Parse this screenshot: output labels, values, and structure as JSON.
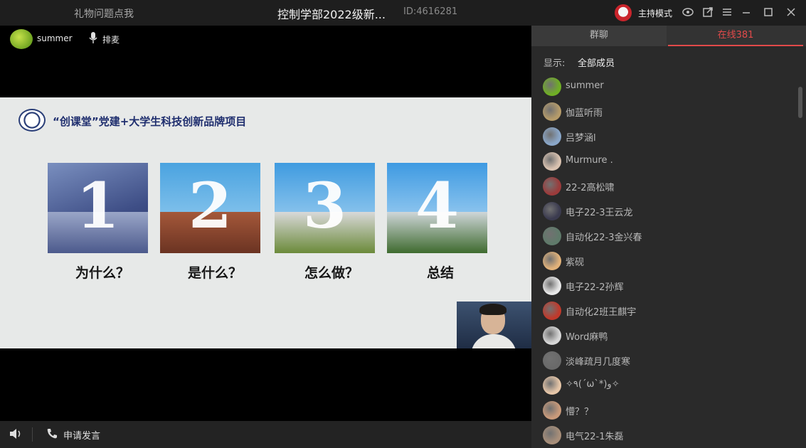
{
  "titlebar": {
    "gift_label": "礼物问题点我",
    "room_title": "控制学部2022级新...",
    "room_id": "ID:4616281",
    "host_mode": "主持模式",
    "icons": [
      "eye-icon",
      "popout-icon",
      "menu-icon",
      "minimize-icon",
      "maximize-icon",
      "close-icon"
    ]
  },
  "stage": {
    "presenter_name": "summer",
    "queue_label": "排麦"
  },
  "slide": {
    "heading": "“创课堂”党建+大学生科技创新品牌项目",
    "cards": [
      {
        "number": "1",
        "caption": "为什么？"
      },
      {
        "number": "2",
        "caption": "是什么？"
      },
      {
        "number": "3",
        "caption": "怎么做？"
      },
      {
        "number": "4",
        "caption": "总结"
      }
    ]
  },
  "bottombar": {
    "apply_label": "申请发言"
  },
  "panel": {
    "tab_group": "群聊",
    "tab_online": "在线381",
    "filter_label": "显示:",
    "filter_value": "全部成员",
    "members": [
      {
        "name": "summer",
        "color": "#6fae25"
      },
      {
        "name": "伽蓝听雨",
        "color": "#b59b6a"
      },
      {
        "name": "吕梦涵l",
        "color": "#8aa7c9"
      },
      {
        "name": "Murmure .",
        "color": "#d9c2b0"
      },
      {
        "name": "22-2高松啸",
        "color": "#9b3b3b"
      },
      {
        "name": "电子22-3王云龙",
        "color": "#3b3b4f"
      },
      {
        "name": "自动化22-3金兴春",
        "color": "#5f7a6a"
      },
      {
        "name": "紫砚",
        "color": "#e1b27a"
      },
      {
        "name": "电子22-2孙辉",
        "color": "#e8e8e8"
      },
      {
        "name": "自动化2班王麒宇",
        "color": "#c0392b"
      },
      {
        "name": "Word麻鸭",
        "color": "#d7d7d7"
      },
      {
        "name": "淡峰疏月几度寒",
        "color": "#6a6a6a"
      },
      {
        "name": "✧٩(ˊωˋ*)و✧",
        "color": "#e6c6a8"
      },
      {
        "name": "懵？？",
        "color": "#c99a7a"
      },
      {
        "name": "电气22-1朱磊",
        "color": "#a88f7a"
      }
    ]
  }
}
